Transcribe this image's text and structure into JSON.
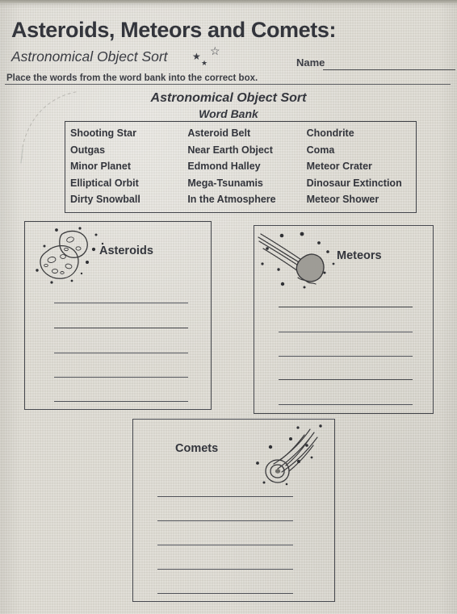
{
  "header": {
    "title": "Asteroids, Meteors and Comets:",
    "subtitle": "Astronomical Object Sort",
    "stars": [
      "★",
      "☆",
      "★"
    ],
    "name_label": "Name",
    "name_value": "",
    "instruction": "Place the words from the word bank into the correct box."
  },
  "word_bank": {
    "title": "Astronomical Object Sort",
    "subtitle": "Word Bank",
    "columns": [
      [
        "Shooting Star",
        "Outgas",
        "Minor Planet",
        "Elliptical Orbit",
        "Dirty Snowball"
      ],
      [
        "Asteroid Belt",
        "Near Earth Object",
        "Edmond Halley",
        "Mega-Tsunamis",
        "In the Atmosphere"
      ],
      [
        "Chondrite",
        "Coma",
        "Meteor Crater",
        "Dinosaur Extinction",
        "Meteor Shower"
      ]
    ]
  },
  "categories": [
    {
      "label": "Asteroids",
      "icon": "asteroid-rocks-icon",
      "line_count": 5,
      "answers": [
        "",
        "",
        "",
        "",
        ""
      ]
    },
    {
      "label": "Meteors",
      "icon": "meteor-streak-icon",
      "line_count": 5,
      "answers": [
        "",
        "",
        "",
        "",
        ""
      ]
    },
    {
      "label": "Comets",
      "icon": "comet-tail-icon",
      "line_count": 5,
      "answers": [
        "",
        "",
        "",
        "",
        ""
      ]
    }
  ],
  "colors": {
    "paper": "#d9d6cd",
    "ink": "#33353c",
    "rule": "#4b4d53",
    "meteor_rock": "#9e9c96"
  }
}
